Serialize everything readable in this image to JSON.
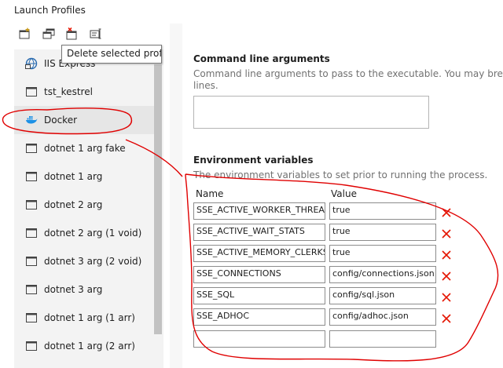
{
  "window": {
    "title": "Launch Profiles"
  },
  "toolbar": {
    "buttons": [
      {
        "name": "new-profile",
        "icon": "new-profile-icon"
      },
      {
        "name": "copy-profile",
        "icon": "copy-profile-icon"
      },
      {
        "name": "delete-profile",
        "icon": "delete-profile-icon"
      },
      {
        "name": "rename-profile",
        "icon": "rename-profile-icon"
      }
    ],
    "tooltip": "Delete selected profile"
  },
  "sidebar": {
    "items": [
      {
        "label": "IIS Express",
        "icon": "iis-icon"
      },
      {
        "label": "tst_kestrel",
        "icon": "window-icon"
      },
      {
        "label": "Docker",
        "icon": "docker-icon",
        "selected": true
      },
      {
        "label": "dotnet 1 arg fake",
        "icon": "window-icon"
      },
      {
        "label": "dotnet 1 arg",
        "icon": "window-icon"
      },
      {
        "label": "dotnet 2 arg",
        "icon": "window-icon"
      },
      {
        "label": "dotnet 2 arg (1 void)",
        "icon": "window-icon"
      },
      {
        "label": "dotnet 3 arg (2 void)",
        "icon": "window-icon"
      },
      {
        "label": "dotnet 3 arg",
        "icon": "window-icon"
      },
      {
        "label": "dotnet 1 arg (1 arr)",
        "icon": "window-icon"
      },
      {
        "label": "dotnet 1 arg (2 arr)",
        "icon": "window-icon"
      }
    ]
  },
  "main": {
    "cmd": {
      "heading": "Command line arguments",
      "desc_line1": "Command line arguments to pass to the executable. You may brea",
      "desc_line2": "lines.",
      "value": ""
    },
    "env": {
      "heading": "Environment variables",
      "desc": "The environment variables to set prior to running the process.",
      "col_name": "Name",
      "col_value": "Value",
      "rows": [
        {
          "name": "SSE_ACTIVE_WORKER_THREAD",
          "value": "true"
        },
        {
          "name": "SSE_ACTIVE_WAIT_STATS",
          "value": "true"
        },
        {
          "name": "SSE_ACTIVE_MEMORY_CLERKS",
          "value": "true"
        },
        {
          "name": "SSE_CONNECTIONS",
          "value": "config/connections.json"
        },
        {
          "name": "SSE_SQL",
          "value": "config/sql.json"
        },
        {
          "name": "SSE_ADHOC",
          "value": "config/adhoc.json"
        }
      ],
      "empty_row": {
        "name": "",
        "value": ""
      }
    }
  },
  "colors": {
    "delete": "#e51400",
    "annotation": "#e00000",
    "docker": "#1d91e6",
    "iis": "#2b6cb0"
  }
}
